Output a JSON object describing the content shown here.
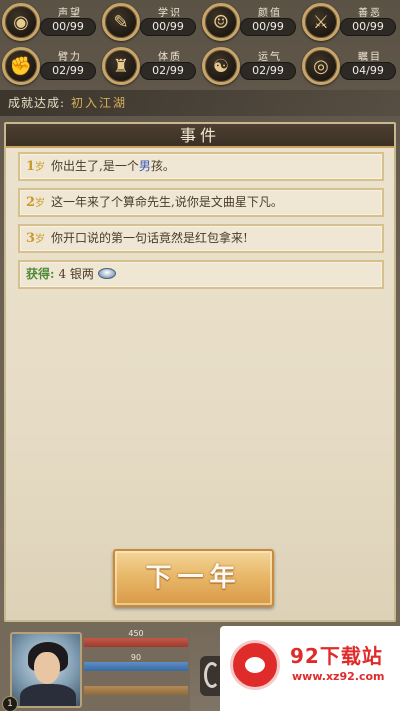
{
  "stats": [
    {
      "label": "声望",
      "value": "00/99",
      "icon": "reputation-icon",
      "glyph": "◉"
    },
    {
      "label": "学识",
      "value": "00/99",
      "icon": "book-icon",
      "glyph": "✎"
    },
    {
      "label": "颜值",
      "value": "00/99",
      "icon": "face-icon",
      "glyph": "☺"
    },
    {
      "label": "善恶",
      "value": "00/99",
      "icon": "crossed-swords-icon",
      "glyph": "⚔"
    },
    {
      "label": "臂力",
      "value": "02/99",
      "icon": "fist-icon",
      "glyph": "✊"
    },
    {
      "label": "体质",
      "value": "02/99",
      "icon": "body-icon",
      "glyph": "♜"
    },
    {
      "label": "运气",
      "value": "02/99",
      "icon": "luck-icon",
      "glyph": "☯"
    },
    {
      "label": "瞩目",
      "value": "04/99",
      "icon": "eye-icon",
      "glyph": "◎"
    }
  ],
  "achievement": {
    "label": "成就达成:",
    "value": "初入江湖"
  },
  "panel": {
    "title": "事件"
  },
  "events": [
    {
      "age": "1",
      "suffix": "岁",
      "pre": "你出生了,是一个",
      "hl": "男",
      "post": "孩。"
    },
    {
      "age": "2",
      "suffix": "岁",
      "pre": "这一年来了个算命先生,说你是文曲星下凡。",
      "hl": "",
      "post": ""
    },
    {
      "age": "3",
      "suffix": "岁",
      "pre": "你开口说的第一句话竟然是红包拿来!",
      "hl": "",
      "post": ""
    }
  ],
  "reward": {
    "label": "获得:",
    "text": "4 银两",
    "icon": "silver-coin-icon"
  },
  "next_button": {
    "label": "下一年"
  },
  "player": {
    "level": "1",
    "hp": {
      "text": "450",
      "fraction": 1.0
    },
    "mp": {
      "text": "90",
      "fraction": 1.0
    },
    "xp": {
      "text": "",
      "fraction": 1.0
    }
  },
  "watermark": {
    "title": "92下载站",
    "url": "www.xz92.com"
  },
  "colors": {
    "accent": "#c99a2b",
    "highlight": "#3b57b8",
    "reward": "#4f8a3a",
    "button": "#e8b86a"
  }
}
